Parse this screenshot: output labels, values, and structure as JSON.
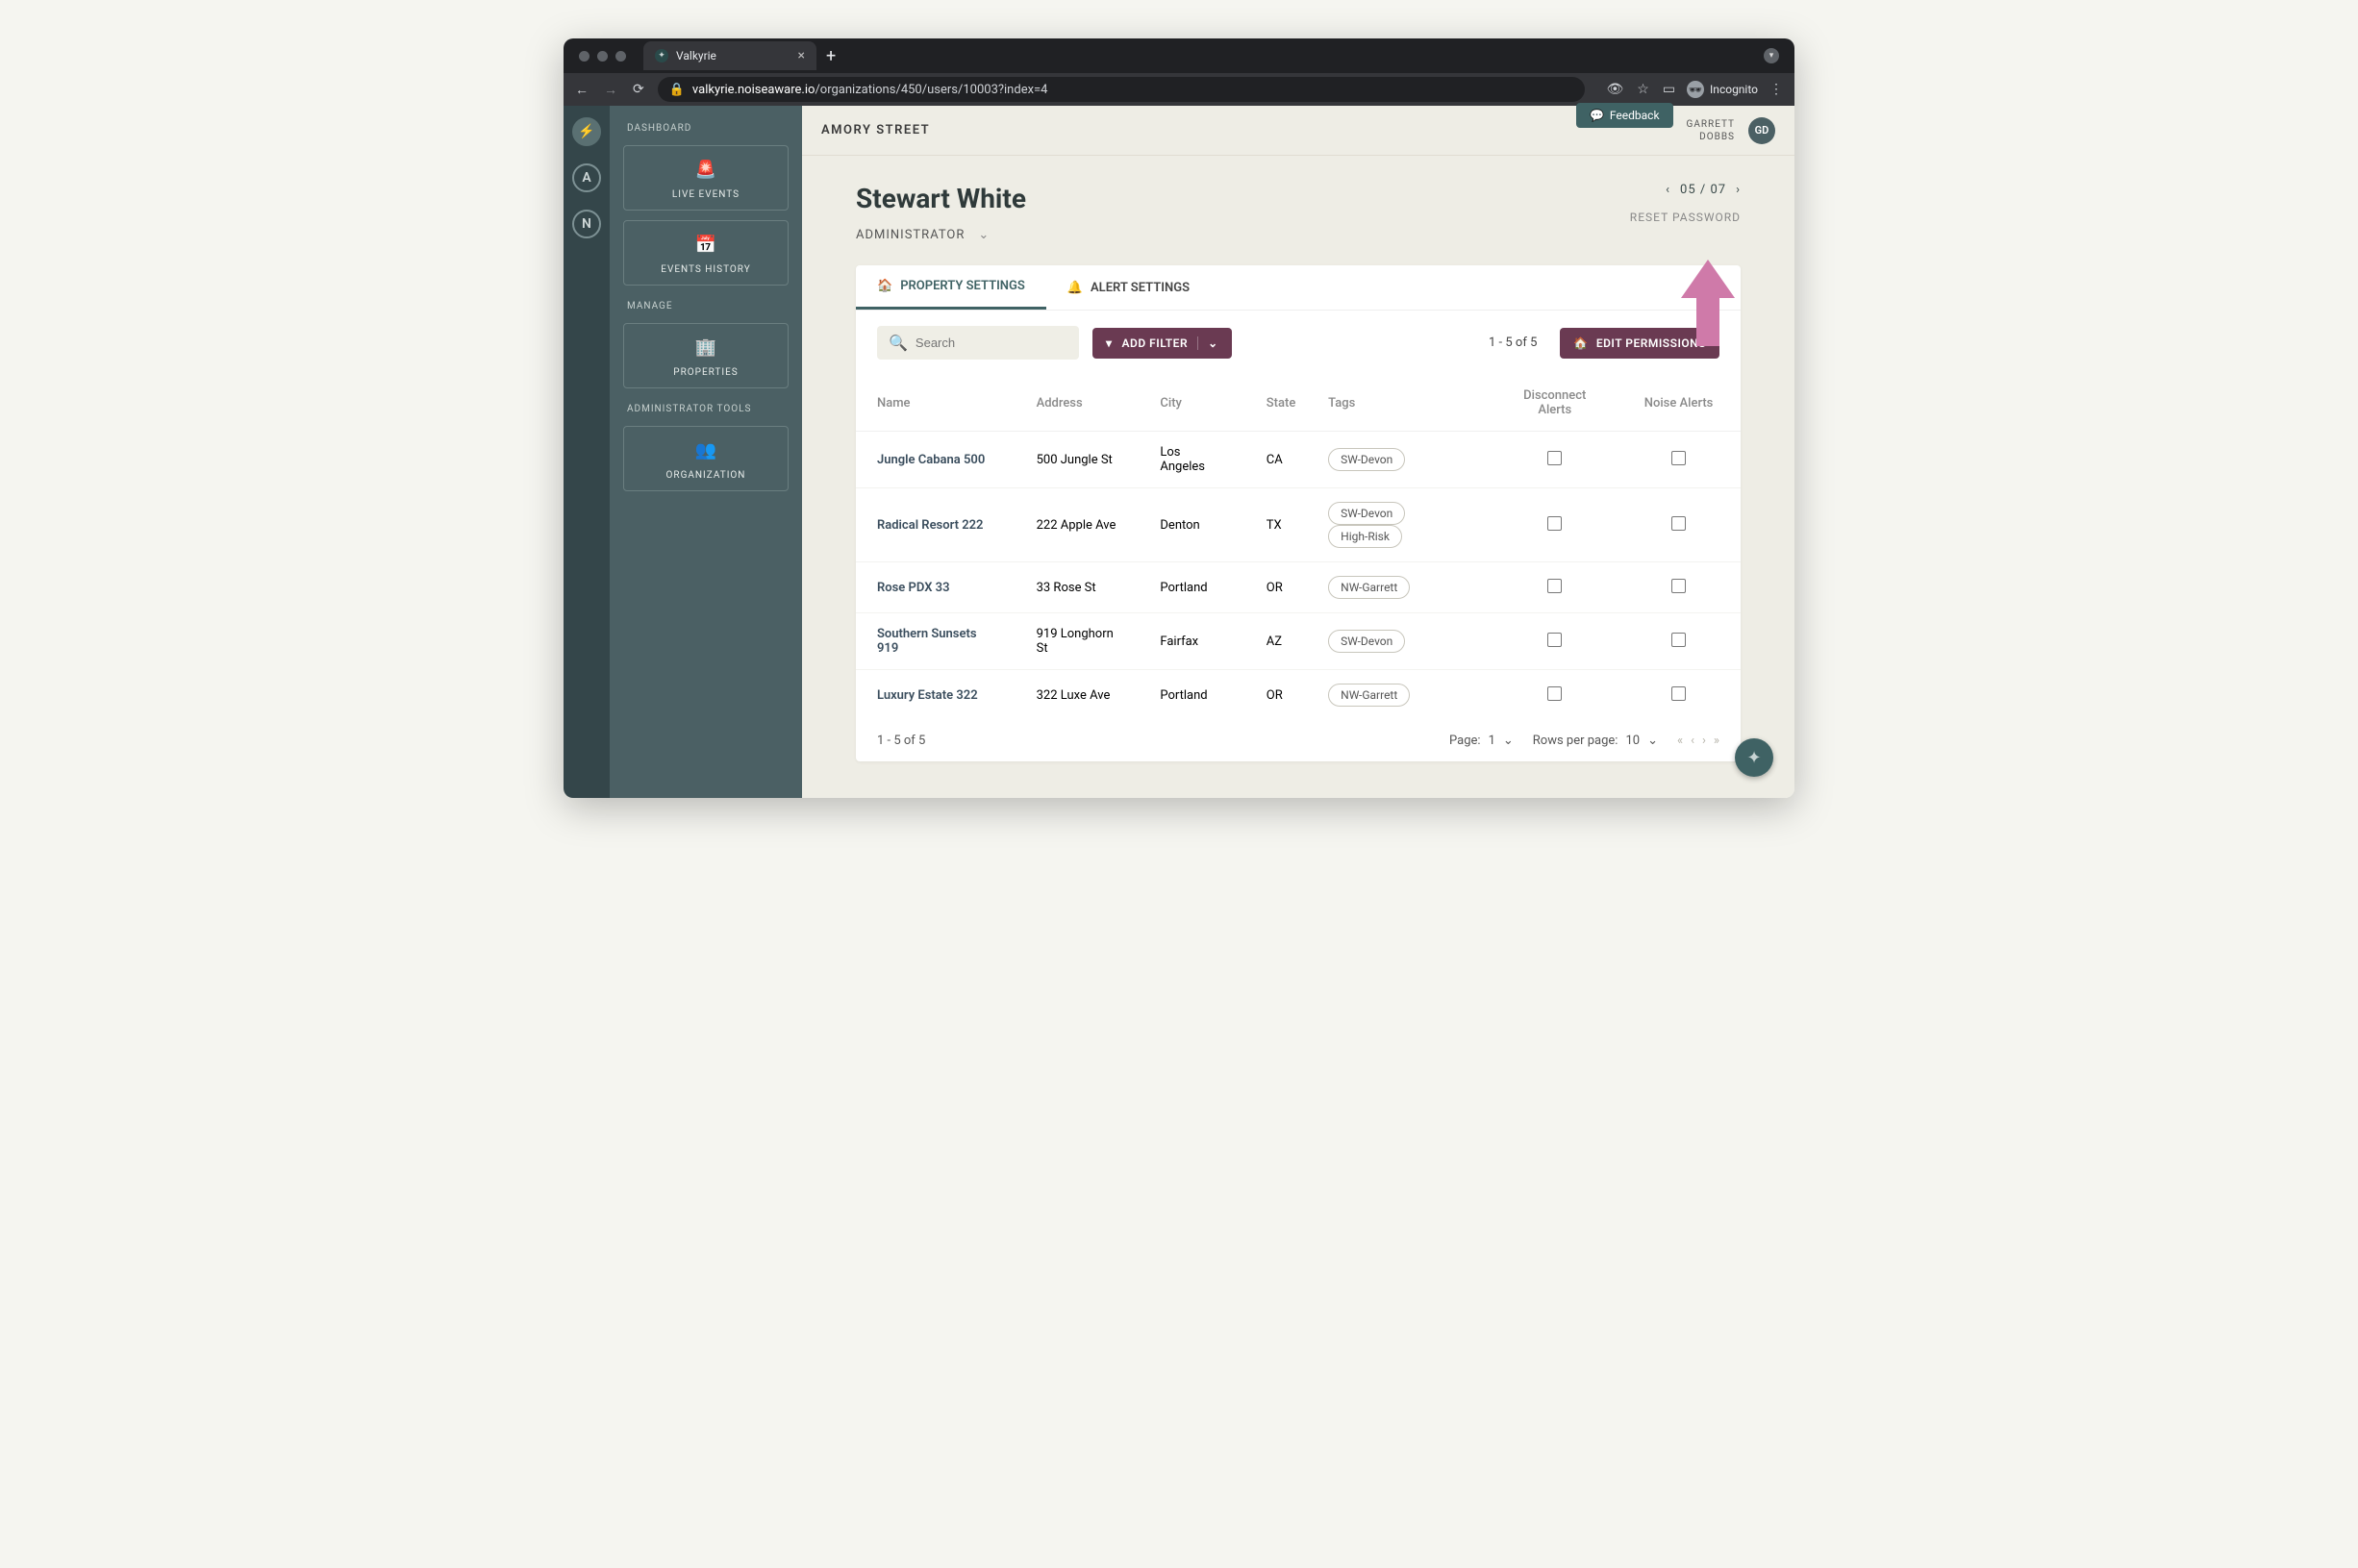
{
  "browser": {
    "tab_title": "Valkyrie",
    "url_host": "valkyrie.noiseaware.io",
    "url_path": "/organizations/450/users/10003?index=4",
    "incognito_label": "Incognito"
  },
  "rail": {
    "items": [
      "",
      "A",
      "N"
    ]
  },
  "sidebar": {
    "sections": {
      "dashboard_label": "DASHBOARD",
      "manage_label": "MANAGE",
      "admin_label": "ADMINISTRATOR TOOLS"
    },
    "live_events": "LIVE EVENTS",
    "events_history": "EVENTS HISTORY",
    "properties": "PROPERTIES",
    "organization": "ORGANIZATION"
  },
  "topbar": {
    "org_name": "AMORY STREET",
    "feedback": "Feedback",
    "user_first": "GARRETT",
    "user_last": "DOBBS",
    "avatar_initials": "GD"
  },
  "page": {
    "user_name": "Stewart White",
    "role": "ADMINISTRATOR",
    "pager_label": "05 / 07",
    "reset_password": "RESET PASSWORD"
  },
  "tabs": {
    "property_settings": "PROPERTY SETTINGS",
    "alert_settings": "ALERT SETTINGS"
  },
  "toolbar": {
    "search_placeholder": "Search",
    "add_filter": "ADD FILTER",
    "count": "1 - 5 of 5",
    "edit_permissions": "EDIT PERMISSIONS"
  },
  "columns": {
    "name": "Name",
    "address": "Address",
    "city": "City",
    "state": "State",
    "tags": "Tags",
    "disconnect": "Disconnect Alerts",
    "noise": "Noise Alerts"
  },
  "rows": [
    {
      "name": "Jungle Cabana 500",
      "address": "500 Jungle St",
      "city": "Los Angeles",
      "state": "CA",
      "tags": [
        "SW-Devon"
      ],
      "disconnect": false,
      "noise": false
    },
    {
      "name": "Radical Resort 222",
      "address": "222 Apple Ave",
      "city": "Denton",
      "state": "TX",
      "tags": [
        "SW-Devon",
        "High-Risk"
      ],
      "disconnect": false,
      "noise": false
    },
    {
      "name": "Rose PDX 33",
      "address": "33 Rose St",
      "city": "Portland",
      "state": "OR",
      "tags": [
        "NW-Garrett"
      ],
      "disconnect": false,
      "noise": false
    },
    {
      "name": "Southern Sunsets 919",
      "address": "919 Longhorn St",
      "city": "Fairfax",
      "state": "AZ",
      "tags": [
        "SW-Devon"
      ],
      "disconnect": false,
      "noise": false
    },
    {
      "name": "Luxury Estate 322",
      "address": "322 Luxe Ave",
      "city": "Portland",
      "state": "OR",
      "tags": [
        "NW-Garrett"
      ],
      "disconnect": false,
      "noise": false
    }
  ],
  "footer": {
    "range": "1 - 5 of 5",
    "page_label": "Page:",
    "page_value": "1",
    "rows_label": "Rows per page:",
    "rows_value": "10"
  }
}
